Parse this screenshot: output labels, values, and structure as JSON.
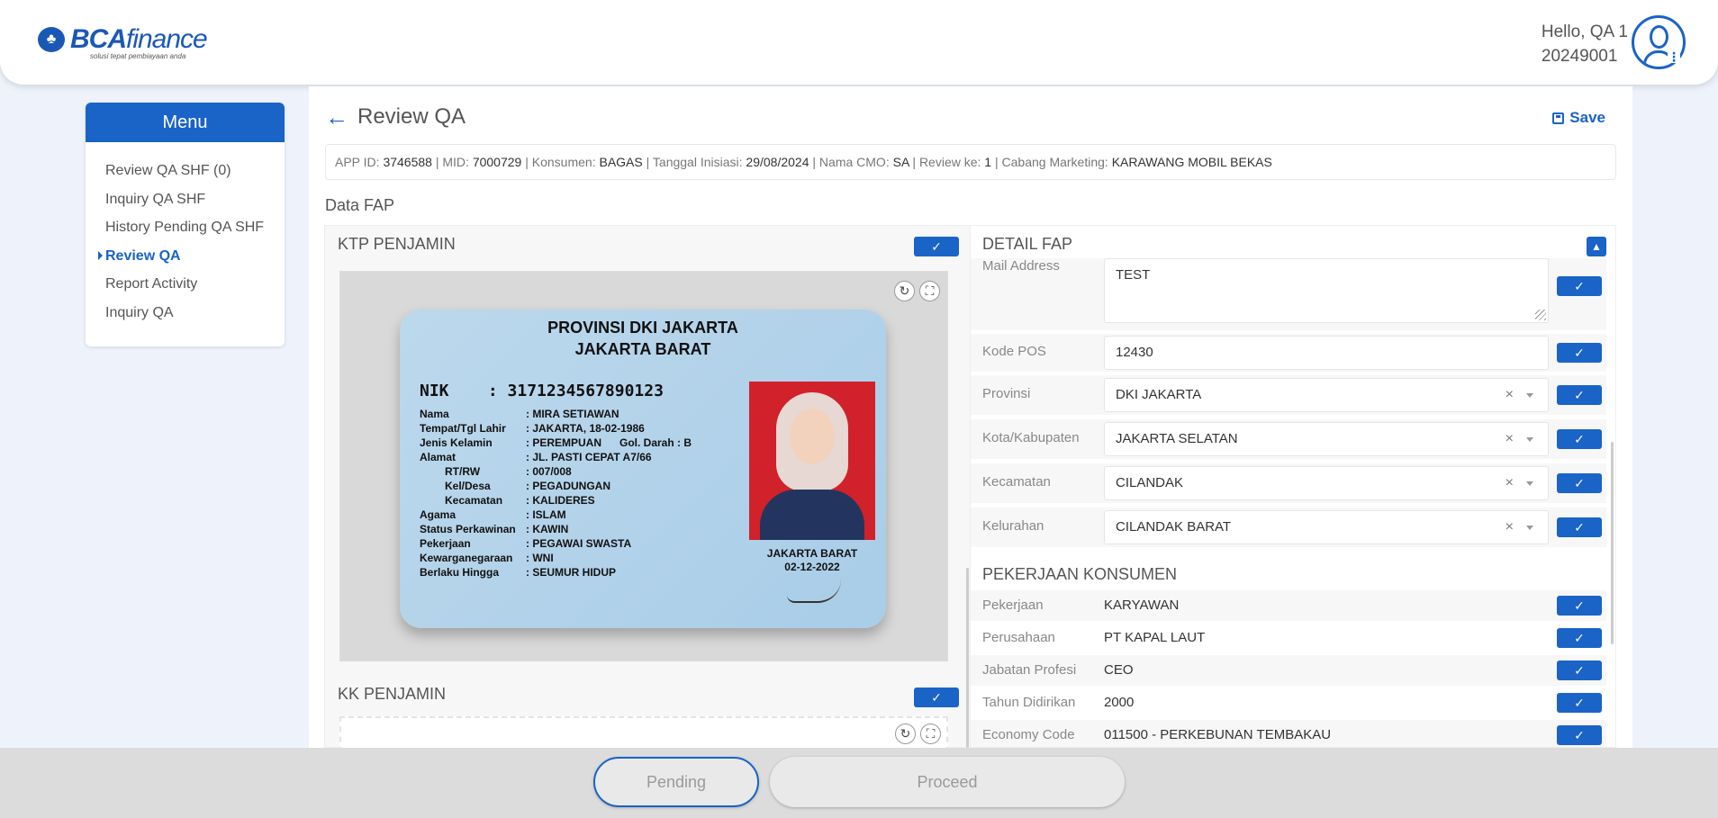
{
  "header": {
    "logo_text_bca": "BCA",
    "logo_text_finance": "finance",
    "logo_tagline": "solusi tepat pembiayaan anda",
    "greeting": "Hello, QA 1",
    "user_id": "20249001"
  },
  "sidebar": {
    "title": "Menu",
    "items": [
      {
        "label": "Review QA SHF (0)"
      },
      {
        "label": "Inquiry QA SHF"
      },
      {
        "label": "History Pending QA SHF"
      },
      {
        "label": "Review QA"
      },
      {
        "label": "Report Activity"
      },
      {
        "label": "Inquiry QA"
      }
    ],
    "active_index": 3
  },
  "main": {
    "title": "Review QA",
    "save_label": "Save",
    "info": {
      "app_id_label": "APP ID:",
      "app_id": "3746588",
      "mid_label": "MID:",
      "mid": "7000729",
      "konsumen_label": "Konsumen:",
      "konsumen": "BAGAS",
      "tanggal_label": "Tanggal Inisiasi:",
      "tanggal": "29/08/2024",
      "cmo_label": "Nama CMO:",
      "cmo": "SA",
      "review_label": "Review ke:",
      "review": "1",
      "cabang_label": "Cabang Marketing:",
      "cabang": "KARAWANG MOBIL BEKAS"
    },
    "section_title": "Data FAP"
  },
  "left_card": {
    "ktp_title": "KTP PENJAMIN",
    "kk_title": "KK PENJAMIN",
    "ktp": {
      "provinsi": "PROVINSI DKI JAKARTA",
      "kota": "JAKARTA BARAT",
      "nik_label": "NIK",
      "nik": ": 3171234567890123",
      "fields": [
        {
          "k": "Nama",
          "v": ": MIRA SETIAWAN"
        },
        {
          "k": "Tempat/Tgl Lahir",
          "v": ": JAKARTA, 18-02-1986"
        },
        {
          "k": "Jenis Kelamin",
          "v": ": PEREMPUAN      Gol. Darah : B"
        },
        {
          "k": "Alamat",
          "v": ": JL. PASTI CEPAT A7/66"
        },
        {
          "k": "RT/RW",
          "v": ": 007/008"
        },
        {
          "k": "Kel/Desa",
          "v": ": PEGADUNGAN"
        },
        {
          "k": "Kecamatan",
          "v": ": KALIDERES"
        },
        {
          "k": "Agama",
          "v": ": ISLAM"
        },
        {
          "k": "Status Perkawinan",
          "v": ": KAWIN"
        },
        {
          "k": "Pekerjaan",
          "v": ": PEGAWAI SWASTA"
        },
        {
          "k": "Kewarganegaraan",
          "v": ": WNI"
        },
        {
          "k": "Berlaku Hingga",
          "v": ": SEUMUR HIDUP"
        }
      ],
      "issue_place": "JAKARTA BARAT",
      "issue_date": "02-12-2022"
    }
  },
  "right_card": {
    "title": "DETAIL FAP",
    "address_fields": [
      {
        "label": "Mail Address",
        "value": "TEST"
      },
      {
        "label": "Kode POS",
        "value": "12430"
      },
      {
        "label": "Provinsi",
        "value": "DKI JAKARTA"
      },
      {
        "label": "Kota/Kabupaten",
        "value": "JAKARTA SELATAN"
      },
      {
        "label": "Kecamatan",
        "value": "CILANDAK"
      },
      {
        "label": "Kelurahan",
        "value": "CILANDAK BARAT"
      }
    ],
    "pekerjaan_title": "PEKERJAAN KONSUMEN",
    "pekerjaan_fields": [
      {
        "label": "Pekerjaan",
        "value": "KARYAWAN"
      },
      {
        "label": "Perusahaan",
        "value": "PT KAPAL LAUT"
      },
      {
        "label": "Jabatan Profesi",
        "value": "CEO"
      },
      {
        "label": "Tahun Didirikan",
        "value": "2000"
      },
      {
        "label": "Economy Code",
        "value": "011500 - PERKEBUNAN TEMBAKAU"
      }
    ]
  },
  "footer": {
    "pending_label": "Pending",
    "proceed_label": "Proceed"
  },
  "icons": {
    "check": "✓",
    "close": "×",
    "chevron_up": "▲",
    "rotate": "↻",
    "expand": "⛶"
  },
  "colors": {
    "primary": "#1a63c7"
  }
}
